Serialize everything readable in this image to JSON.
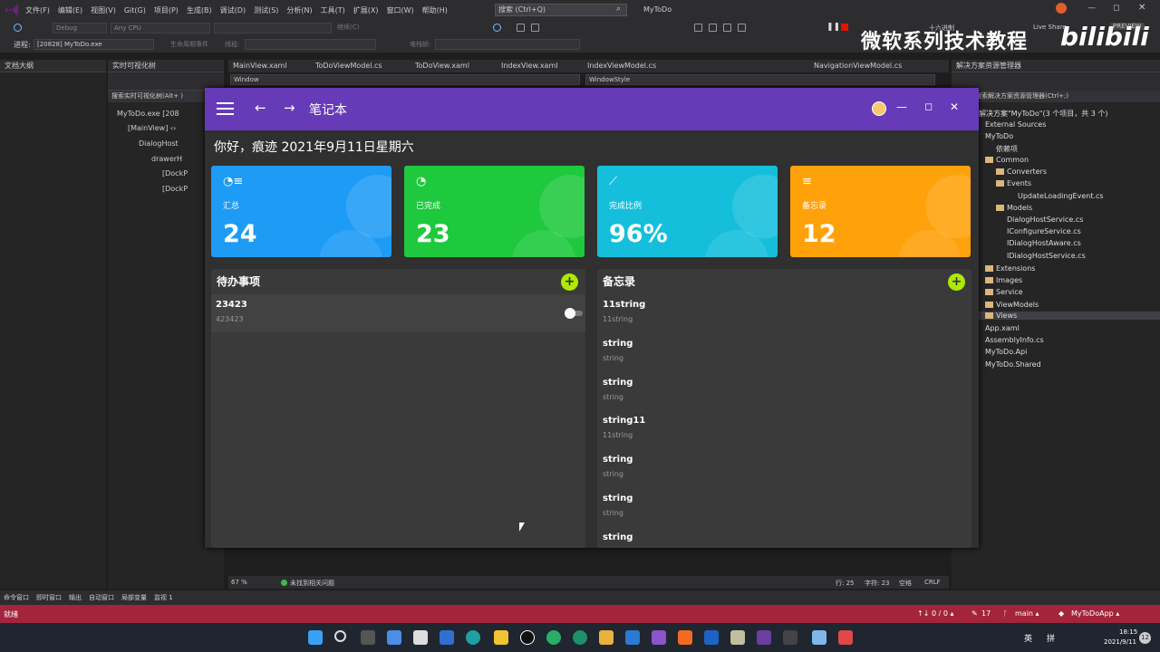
{
  "menu": [
    "文件(F)",
    "编辑(E)",
    "视图(V)",
    "Git(G)",
    "项目(P)",
    "生成(B)",
    "调试(D)",
    "测试(S)",
    "分析(N)",
    "工具(T)",
    "扩展(X)",
    "窗口(W)",
    "帮助(H)"
  ],
  "search": {
    "placeholder": "搜索 (Ctrl+Q)"
  },
  "window_title": "MyToDo",
  "toolbar": {
    "config": "Debug",
    "platform": "Any CPU",
    "start": "继续(C)",
    "process_label": "进程:",
    "process": "[20828] MyToDo.exe",
    "lifecycle": "生命周期事件",
    "thread": "线程:",
    "stackframe": "堆栈帧:",
    "hex": "十六进制",
    "liveshare": "Live Share",
    "preview": "PREVIEW"
  },
  "watermark": {
    "text": "微软系列技术教程",
    "logo": "bilibili"
  },
  "doc_outline": {
    "title": "文档大纲"
  },
  "live_tree": {
    "title": "实时可视化树",
    "search": "搜索实时可视化树(Alt+ )",
    "items": [
      "MyToDo.exe [208",
      "[MainView] ‹›",
      "DialogHost",
      "drawerH",
      "[DockP",
      "[DockP"
    ]
  },
  "editor_tabs": [
    "MainView.xaml",
    "ToDoViewModel.cs",
    "ToDoView.xaml",
    "IndexView.xaml",
    "IndexViewModel.cs",
    "NavigationViewModel.cs"
  ],
  "editor_dropdowns": {
    "left": "Window",
    "right": "WindowStyle"
  },
  "solution": {
    "title": "解决方案资源管理器",
    "search": "搜索解决方案资源管理器(Ctrl+;)",
    "header": "解决方案\"MyToDo\"(3 个项目，共 3 个)",
    "items": [
      "External Sources",
      "MyToDo",
      "依赖项",
      "Common",
      "Converters",
      "Events",
      "UpdateLoadingEvent.cs",
      "Models",
      "DialogHostService.cs",
      "IConfigureService.cs",
      "IDialogHostAware.cs",
      "IDialogHostService.cs",
      "Extensions",
      "Images",
      "Service",
      "ViewModels",
      "Views",
      "App.xaml",
      "AssemblyInfo.cs",
      "MyToDo.Api",
      "MyToDo.Shared"
    ]
  },
  "app": {
    "title": "笔记本",
    "greeting": "你好，痕迹 2021年9月11日星期六",
    "cards": [
      {
        "icon": "clock-list-icon",
        "label": "汇总",
        "value": "24",
        "color": "#1e9bf5"
      },
      {
        "icon": "clock-check-icon",
        "label": "已完成",
        "value": "23",
        "color": "#1ec93d"
      },
      {
        "icon": "trend-icon",
        "label": "完成比例",
        "value": "96%",
        "color": "#15bfdc"
      },
      {
        "icon": "memo-icon",
        "label": "备忘录",
        "value": "12",
        "color": "#ffa10a"
      }
    ],
    "todo": {
      "title": "待办事项",
      "add": "+",
      "items": [
        {
          "title": "23423",
          "content": "423423"
        }
      ]
    },
    "memo": {
      "title": "备忘录",
      "add": "+",
      "items": [
        {
          "title": "11string",
          "content": "11string"
        },
        {
          "title": "string",
          "content": "string"
        },
        {
          "title": "string",
          "content": "string"
        },
        {
          "title": "string11",
          "content": "11string"
        },
        {
          "title": "string",
          "content": "string"
        },
        {
          "title": "string",
          "content": "string"
        },
        {
          "title": "string",
          "content": ""
        }
      ]
    }
  },
  "editor_status": {
    "zoom": "67 %",
    "issues": "未找到相关问题",
    "line": "行: 25",
    "char": "字符: 23",
    "ws": "空格",
    "eol": "CRLF"
  },
  "bottom_tabs": [
    "命令窗口",
    "即时窗口",
    "输出",
    "自动窗口",
    "局部变量",
    "监视 1"
  ],
  "statusbar": {
    "ready": "就绪",
    "updown": "↑↓ 0 / 0 ▴",
    "pencil": "17",
    "branch": "main ▴",
    "repo": "MyToDoApp ▴"
  },
  "taskbar": {
    "ime1": "英",
    "ime2": "拼",
    "time": "18:15",
    "date": "2021/9/11",
    "badge": "12"
  }
}
